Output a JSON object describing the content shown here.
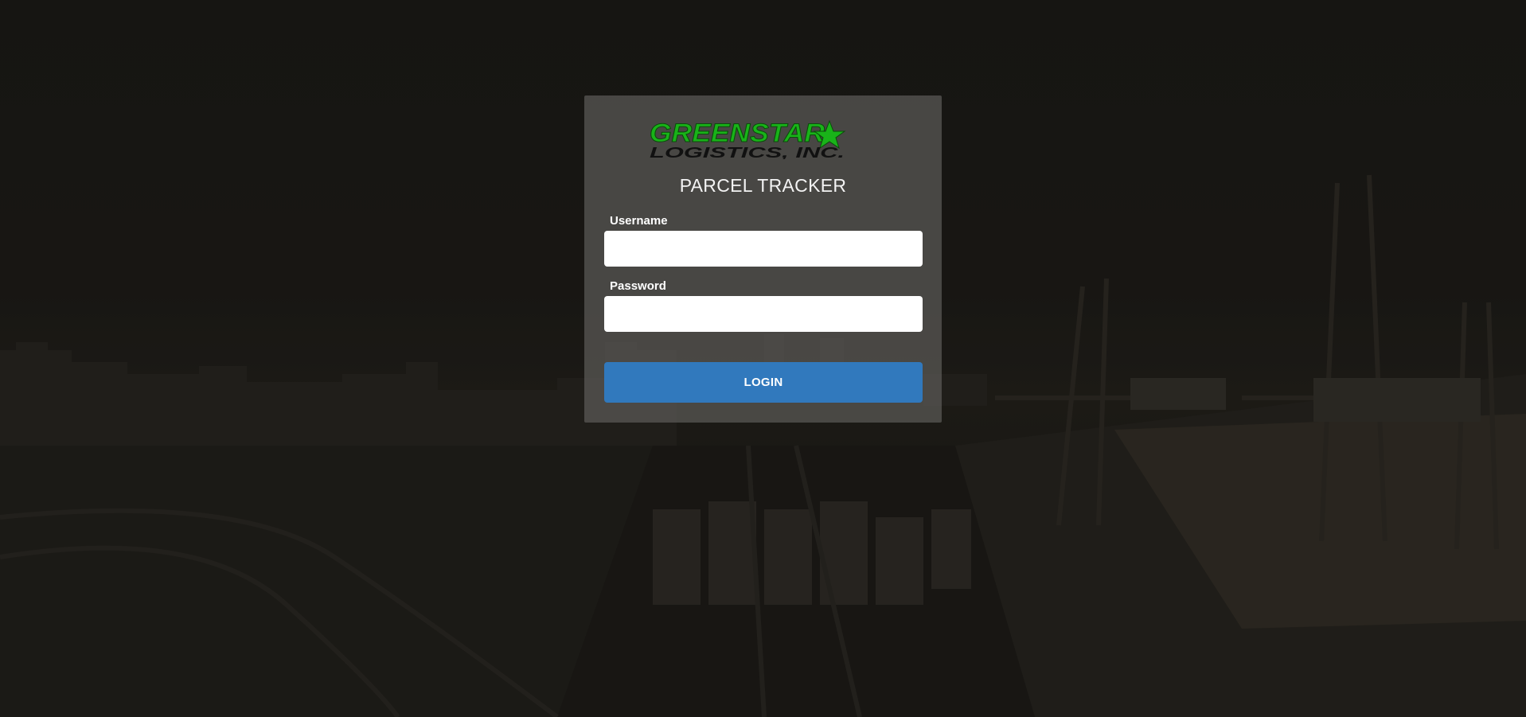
{
  "app": {
    "logo": {
      "line1": "GREENSTAR",
      "line2": "LOGISTICS, INC.",
      "star_icon": "star-icon",
      "brand_color": "#19b319"
    },
    "title": "PARCEL TRACKER"
  },
  "login_form": {
    "username_label": "Username",
    "username_value": "",
    "password_label": "Password",
    "password_value": "",
    "login_label": "LOGIN",
    "button_color": "#3179bd"
  }
}
